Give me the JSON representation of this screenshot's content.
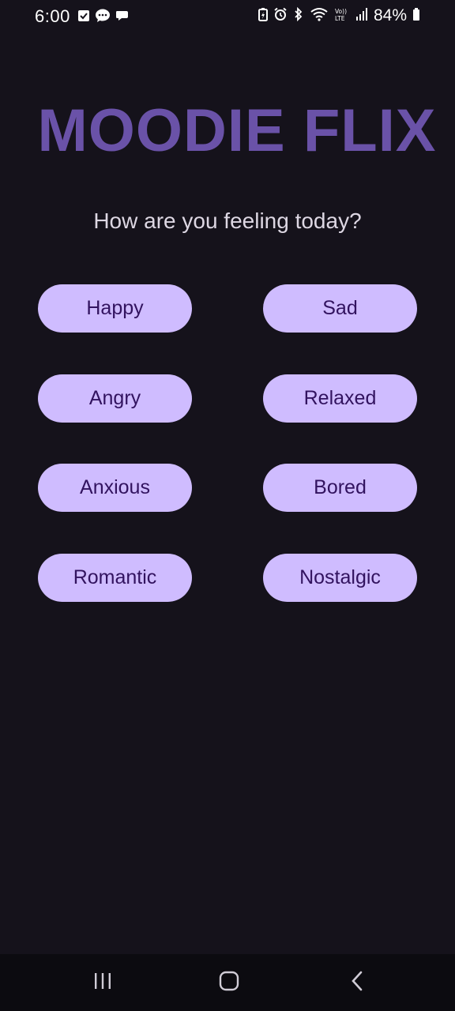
{
  "status_bar": {
    "time": "6:00",
    "battery_percent": "84%",
    "left_icons": [
      "checkbox-icon",
      "chat-bubble-icon",
      "message-icon"
    ],
    "right_icons": [
      "battery-saver-icon",
      "alarm-icon",
      "bluetooth-icon",
      "wifi-icon",
      "volte-icon",
      "signal-icon",
      "battery-icon"
    ],
    "volte_label": "Vo)) LTE"
  },
  "app": {
    "title": "MOODIE FLIX",
    "prompt": "How are you feeling today?",
    "title_color": "#6a52a8",
    "button_color": "#cfbcff",
    "button_text_color": "#32135f",
    "background_color": "#15121b"
  },
  "moods": [
    {
      "label": "Happy"
    },
    {
      "label": "Sad"
    },
    {
      "label": "Angry"
    },
    {
      "label": "Relaxed"
    },
    {
      "label": "Anxious"
    },
    {
      "label": "Bored"
    },
    {
      "label": "Romantic"
    },
    {
      "label": "Nostalgic"
    }
  ],
  "nav_bar": {
    "icons": [
      "recent-apps-icon",
      "home-icon",
      "back-icon"
    ]
  }
}
